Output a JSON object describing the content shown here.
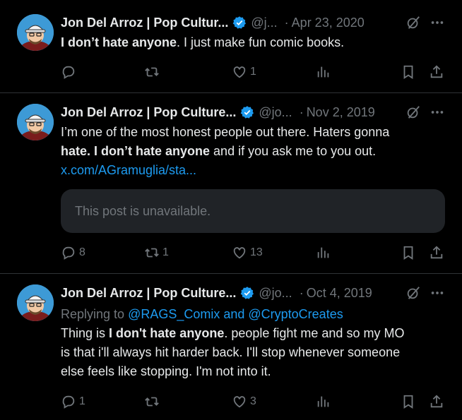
{
  "tweets": [
    {
      "author": "Jon Del Arroz | Pop Cultur...",
      "handle": "@j...",
      "date": "Apr 23, 2020",
      "text_bold1": "I don’t hate anyone",
      "text_rest1": ". I just make fun comic books.",
      "reply_count": "",
      "retweet_count": "",
      "like_count": "1"
    },
    {
      "author": "Jon Del Arroz | Pop Culture...",
      "handle": "@jo...",
      "date": "Nov 2, 2019",
      "line1": "I’m one of the most honest people out there. Haters gonna",
      "bold_a": "hate",
      "mid": ". ",
      "bold_b": "I don’t hate anyone",
      "rest": " and if you ask me to you out.",
      "link": "x.com/AGramuglia/sta...",
      "quote_text": "This post is unavailable.",
      "reply_count": "8",
      "retweet_count": "1",
      "like_count": "13"
    },
    {
      "author": "Jon Del Arroz | Pop Culture...",
      "handle": "@jo...",
      "date": "Oct 4, 2019",
      "replying_prefix": "Replying to ",
      "replying_users": "@RAGS_Comix and @CryptoCreates",
      "pre": "Thing is ",
      "bold": "I don't hate anyone",
      "post1": ". people fight me and so my MO",
      "line2": "is that i'll always hit harder back. I'll stop whenever someone",
      "line3": "else feels like stopping. I'm not into it.",
      "reply_count": "1",
      "retweet_count": "",
      "like_count": "3"
    }
  ],
  "colors": {
    "background": "#000000",
    "text": "#e7e9ea",
    "muted": "#71767b",
    "link": "#1d9bf0",
    "verified": "#1d9bf0",
    "divider": "#2f3336"
  }
}
